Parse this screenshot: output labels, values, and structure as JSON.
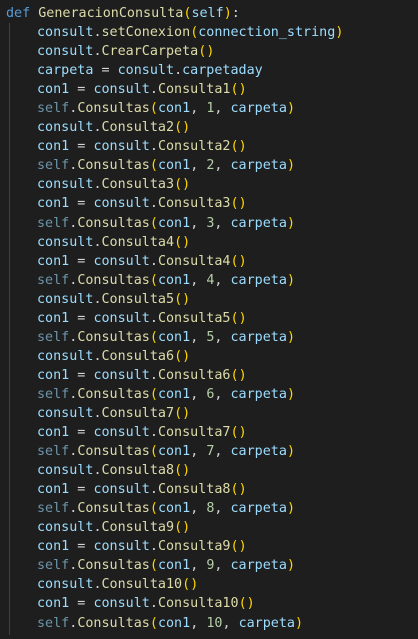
{
  "editor": {
    "colors": {
      "background": "#1e1e1e",
      "keyword": "#569cd6",
      "function": "#dcdcaa",
      "variable": "#9cdcfe",
      "number": "#b5cea8",
      "paren_level1": "#ffd700",
      "paren_level2": "#da70d6",
      "default": "#d4d4d4"
    },
    "lines": [
      {
        "tokens": [
          [
            "keyword",
            "def"
          ],
          [
            "punct",
            " "
          ],
          [
            "func",
            "GeneracionConsulta"
          ],
          [
            "paren1",
            "("
          ],
          [
            "param",
            "self"
          ],
          [
            "paren1",
            ")"
          ],
          [
            "punct",
            ":"
          ]
        ],
        "indent": 0
      },
      {
        "tokens": [
          [
            "var",
            "consult"
          ],
          [
            "punct",
            "."
          ],
          [
            "method",
            "setConexion"
          ],
          [
            "paren1",
            "("
          ],
          [
            "var",
            "connection_string"
          ],
          [
            "paren1",
            ")"
          ]
        ],
        "indent": 1
      },
      {
        "tokens": [
          [
            "var",
            "consult"
          ],
          [
            "punct",
            "."
          ],
          [
            "method",
            "CrearCarpeta"
          ],
          [
            "paren1",
            "("
          ],
          [
            "paren1",
            ")"
          ]
        ],
        "indent": 1
      },
      {
        "tokens": [
          [
            "var",
            "carpeta"
          ],
          [
            "punct",
            " = "
          ],
          [
            "var",
            "consult"
          ],
          [
            "punct",
            "."
          ],
          [
            "var",
            "carpetaday"
          ]
        ],
        "indent": 1
      },
      {
        "tokens": [
          [
            "var",
            "con1"
          ],
          [
            "punct",
            " = "
          ],
          [
            "var",
            "consult"
          ],
          [
            "punct",
            "."
          ],
          [
            "method",
            "Consulta1"
          ],
          [
            "paren1",
            "("
          ],
          [
            "paren1",
            ")"
          ]
        ],
        "indent": 1
      },
      {
        "tokens": [
          [
            "selfdim",
            "self"
          ],
          [
            "punct",
            "."
          ],
          [
            "method",
            "Consultas"
          ],
          [
            "paren1",
            "("
          ],
          [
            "var",
            "con1"
          ],
          [
            "punct",
            ", "
          ],
          [
            "number",
            "1"
          ],
          [
            "punct",
            ", "
          ],
          [
            "var",
            "carpeta"
          ],
          [
            "paren1",
            ")"
          ]
        ],
        "indent": 1
      },
      {
        "tokens": [
          [
            "var",
            "consult"
          ],
          [
            "punct",
            "."
          ],
          [
            "method",
            "Consulta2"
          ],
          [
            "paren1",
            "("
          ],
          [
            "paren1",
            ")"
          ]
        ],
        "indent": 1
      },
      {
        "tokens": [
          [
            "var",
            "con1"
          ],
          [
            "punct",
            " = "
          ],
          [
            "var",
            "consult"
          ],
          [
            "punct",
            "."
          ],
          [
            "method",
            "Consulta2"
          ],
          [
            "paren1",
            "("
          ],
          [
            "paren1",
            ")"
          ]
        ],
        "indent": 1
      },
      {
        "tokens": [
          [
            "selfdim",
            "self"
          ],
          [
            "punct",
            "."
          ],
          [
            "method",
            "Consultas"
          ],
          [
            "paren1",
            "("
          ],
          [
            "var",
            "con1"
          ],
          [
            "punct",
            ", "
          ],
          [
            "number",
            "2"
          ],
          [
            "punct",
            ", "
          ],
          [
            "var",
            "carpeta"
          ],
          [
            "paren1",
            ")"
          ]
        ],
        "indent": 1
      },
      {
        "tokens": [
          [
            "var",
            "consult"
          ],
          [
            "punct",
            "."
          ],
          [
            "method",
            "Consulta3"
          ],
          [
            "paren1",
            "("
          ],
          [
            "paren1",
            ")"
          ]
        ],
        "indent": 1
      },
      {
        "tokens": [
          [
            "var",
            "con1"
          ],
          [
            "punct",
            " = "
          ],
          [
            "var",
            "consult"
          ],
          [
            "punct",
            "."
          ],
          [
            "method",
            "Consulta3"
          ],
          [
            "paren1",
            "("
          ],
          [
            "paren1",
            ")"
          ]
        ],
        "indent": 1
      },
      {
        "tokens": [
          [
            "selfdim",
            "self"
          ],
          [
            "punct",
            "."
          ],
          [
            "method",
            "Consultas"
          ],
          [
            "paren1",
            "("
          ],
          [
            "var",
            "con1"
          ],
          [
            "punct",
            ", "
          ],
          [
            "number",
            "3"
          ],
          [
            "punct",
            ", "
          ],
          [
            "var",
            "carpeta"
          ],
          [
            "paren1",
            ")"
          ]
        ],
        "indent": 1
      },
      {
        "tokens": [
          [
            "var",
            "consult"
          ],
          [
            "punct",
            "."
          ],
          [
            "method",
            "Consulta4"
          ],
          [
            "paren1",
            "("
          ],
          [
            "paren1",
            ")"
          ]
        ],
        "indent": 1
      },
      {
        "tokens": [
          [
            "var",
            "con1"
          ],
          [
            "punct",
            " = "
          ],
          [
            "var",
            "consult"
          ],
          [
            "punct",
            "."
          ],
          [
            "method",
            "Consulta4"
          ],
          [
            "paren1",
            "("
          ],
          [
            "paren1",
            ")"
          ]
        ],
        "indent": 1
      },
      {
        "tokens": [
          [
            "selfdim",
            "self"
          ],
          [
            "punct",
            "."
          ],
          [
            "method",
            "Consultas"
          ],
          [
            "paren1",
            "("
          ],
          [
            "var",
            "con1"
          ],
          [
            "punct",
            ", "
          ],
          [
            "number",
            "4"
          ],
          [
            "punct",
            ", "
          ],
          [
            "var",
            "carpeta"
          ],
          [
            "paren1",
            ")"
          ]
        ],
        "indent": 1
      },
      {
        "tokens": [
          [
            "var",
            "consult"
          ],
          [
            "punct",
            "."
          ],
          [
            "method",
            "Consulta5"
          ],
          [
            "paren1",
            "("
          ],
          [
            "paren1",
            ")"
          ]
        ],
        "indent": 1
      },
      {
        "tokens": [
          [
            "var",
            "con1"
          ],
          [
            "punct",
            " = "
          ],
          [
            "var",
            "consult"
          ],
          [
            "punct",
            "."
          ],
          [
            "method",
            "Consulta5"
          ],
          [
            "paren1",
            "("
          ],
          [
            "paren1",
            ")"
          ]
        ],
        "indent": 1
      },
      {
        "tokens": [
          [
            "selfdim",
            "self"
          ],
          [
            "punct",
            "."
          ],
          [
            "method",
            "Consultas"
          ],
          [
            "paren1",
            "("
          ],
          [
            "var",
            "con1"
          ],
          [
            "punct",
            ", "
          ],
          [
            "number",
            "5"
          ],
          [
            "punct",
            ", "
          ],
          [
            "var",
            "carpeta"
          ],
          [
            "paren1",
            ")"
          ]
        ],
        "indent": 1
      },
      {
        "tokens": [
          [
            "var",
            "consult"
          ],
          [
            "punct",
            "."
          ],
          [
            "method",
            "Consulta6"
          ],
          [
            "paren1",
            "("
          ],
          [
            "paren1",
            ")"
          ]
        ],
        "indent": 1
      },
      {
        "tokens": [
          [
            "var",
            "con1"
          ],
          [
            "punct",
            " = "
          ],
          [
            "var",
            "consult"
          ],
          [
            "punct",
            "."
          ],
          [
            "method",
            "Consulta6"
          ],
          [
            "paren1",
            "("
          ],
          [
            "paren1",
            ")"
          ]
        ],
        "indent": 1
      },
      {
        "tokens": [
          [
            "selfdim",
            "self"
          ],
          [
            "punct",
            "."
          ],
          [
            "method",
            "Consultas"
          ],
          [
            "paren1",
            "("
          ],
          [
            "var",
            "con1"
          ],
          [
            "punct",
            ", "
          ],
          [
            "number",
            "6"
          ],
          [
            "punct",
            ", "
          ],
          [
            "var",
            "carpeta"
          ],
          [
            "paren1",
            ")"
          ]
        ],
        "indent": 1
      },
      {
        "tokens": [
          [
            "var",
            "consult"
          ],
          [
            "punct",
            "."
          ],
          [
            "method",
            "Consulta7"
          ],
          [
            "paren1",
            "("
          ],
          [
            "paren1",
            ")"
          ]
        ],
        "indent": 1
      },
      {
        "tokens": [
          [
            "var",
            "con1"
          ],
          [
            "punct",
            " = "
          ],
          [
            "var",
            "consult"
          ],
          [
            "punct",
            "."
          ],
          [
            "method",
            "Consulta7"
          ],
          [
            "paren1",
            "("
          ],
          [
            "paren1",
            ")"
          ]
        ],
        "indent": 1
      },
      {
        "tokens": [
          [
            "selfdim",
            "self"
          ],
          [
            "punct",
            "."
          ],
          [
            "method",
            "Consultas"
          ],
          [
            "paren1",
            "("
          ],
          [
            "var",
            "con1"
          ],
          [
            "punct",
            ", "
          ],
          [
            "number",
            "7"
          ],
          [
            "punct",
            ", "
          ],
          [
            "var",
            "carpeta"
          ],
          [
            "paren1",
            ")"
          ]
        ],
        "indent": 1
      },
      {
        "tokens": [
          [
            "var",
            "consult"
          ],
          [
            "punct",
            "."
          ],
          [
            "method",
            "Consulta8"
          ],
          [
            "paren1",
            "("
          ],
          [
            "paren1",
            ")"
          ]
        ],
        "indent": 1
      },
      {
        "tokens": [
          [
            "var",
            "con1"
          ],
          [
            "punct",
            " = "
          ],
          [
            "var",
            "consult"
          ],
          [
            "punct",
            "."
          ],
          [
            "method",
            "Consulta8"
          ],
          [
            "paren1",
            "("
          ],
          [
            "paren1",
            ")"
          ]
        ],
        "indent": 1
      },
      {
        "tokens": [
          [
            "selfdim",
            "self"
          ],
          [
            "punct",
            "."
          ],
          [
            "method",
            "Consultas"
          ],
          [
            "paren1",
            "("
          ],
          [
            "var",
            "con1"
          ],
          [
            "punct",
            ", "
          ],
          [
            "number",
            "8"
          ],
          [
            "punct",
            ", "
          ],
          [
            "var",
            "carpeta"
          ],
          [
            "paren1",
            ")"
          ]
        ],
        "indent": 1
      },
      {
        "tokens": [
          [
            "var",
            "consult"
          ],
          [
            "punct",
            "."
          ],
          [
            "method",
            "Consulta9"
          ],
          [
            "paren1",
            "("
          ],
          [
            "paren1",
            ")"
          ]
        ],
        "indent": 1
      },
      {
        "tokens": [
          [
            "var",
            "con1"
          ],
          [
            "punct",
            " = "
          ],
          [
            "var",
            "consult"
          ],
          [
            "punct",
            "."
          ],
          [
            "method",
            "Consulta9"
          ],
          [
            "paren1",
            "("
          ],
          [
            "paren1",
            ")"
          ]
        ],
        "indent": 1
      },
      {
        "tokens": [
          [
            "selfdim",
            "self"
          ],
          [
            "punct",
            "."
          ],
          [
            "method",
            "Consultas"
          ],
          [
            "paren1",
            "("
          ],
          [
            "var",
            "con1"
          ],
          [
            "punct",
            ", "
          ],
          [
            "number",
            "9"
          ],
          [
            "punct",
            ", "
          ],
          [
            "var",
            "carpeta"
          ],
          [
            "paren1",
            ")"
          ]
        ],
        "indent": 1
      },
      {
        "tokens": [
          [
            "var",
            "consult"
          ],
          [
            "punct",
            "."
          ],
          [
            "method",
            "Consulta10"
          ],
          [
            "paren1",
            "("
          ],
          [
            "paren1",
            ")"
          ]
        ],
        "indent": 1
      },
      {
        "tokens": [
          [
            "var",
            "con1"
          ],
          [
            "punct",
            " = "
          ],
          [
            "var",
            "consult"
          ],
          [
            "punct",
            "."
          ],
          [
            "method",
            "Consulta10"
          ],
          [
            "paren1",
            "("
          ],
          [
            "paren1",
            ")"
          ]
        ],
        "indent": 1
      },
      {
        "tokens": [
          [
            "selfdim",
            "self"
          ],
          [
            "punct",
            "."
          ],
          [
            "method",
            "Consultas"
          ],
          [
            "paren1",
            "("
          ],
          [
            "var",
            "con1"
          ],
          [
            "punct",
            ", "
          ],
          [
            "number",
            "10"
          ],
          [
            "punct",
            ", "
          ],
          [
            "var",
            "carpeta"
          ],
          [
            "paren1",
            ")"
          ]
        ],
        "indent": 1
      }
    ]
  }
}
